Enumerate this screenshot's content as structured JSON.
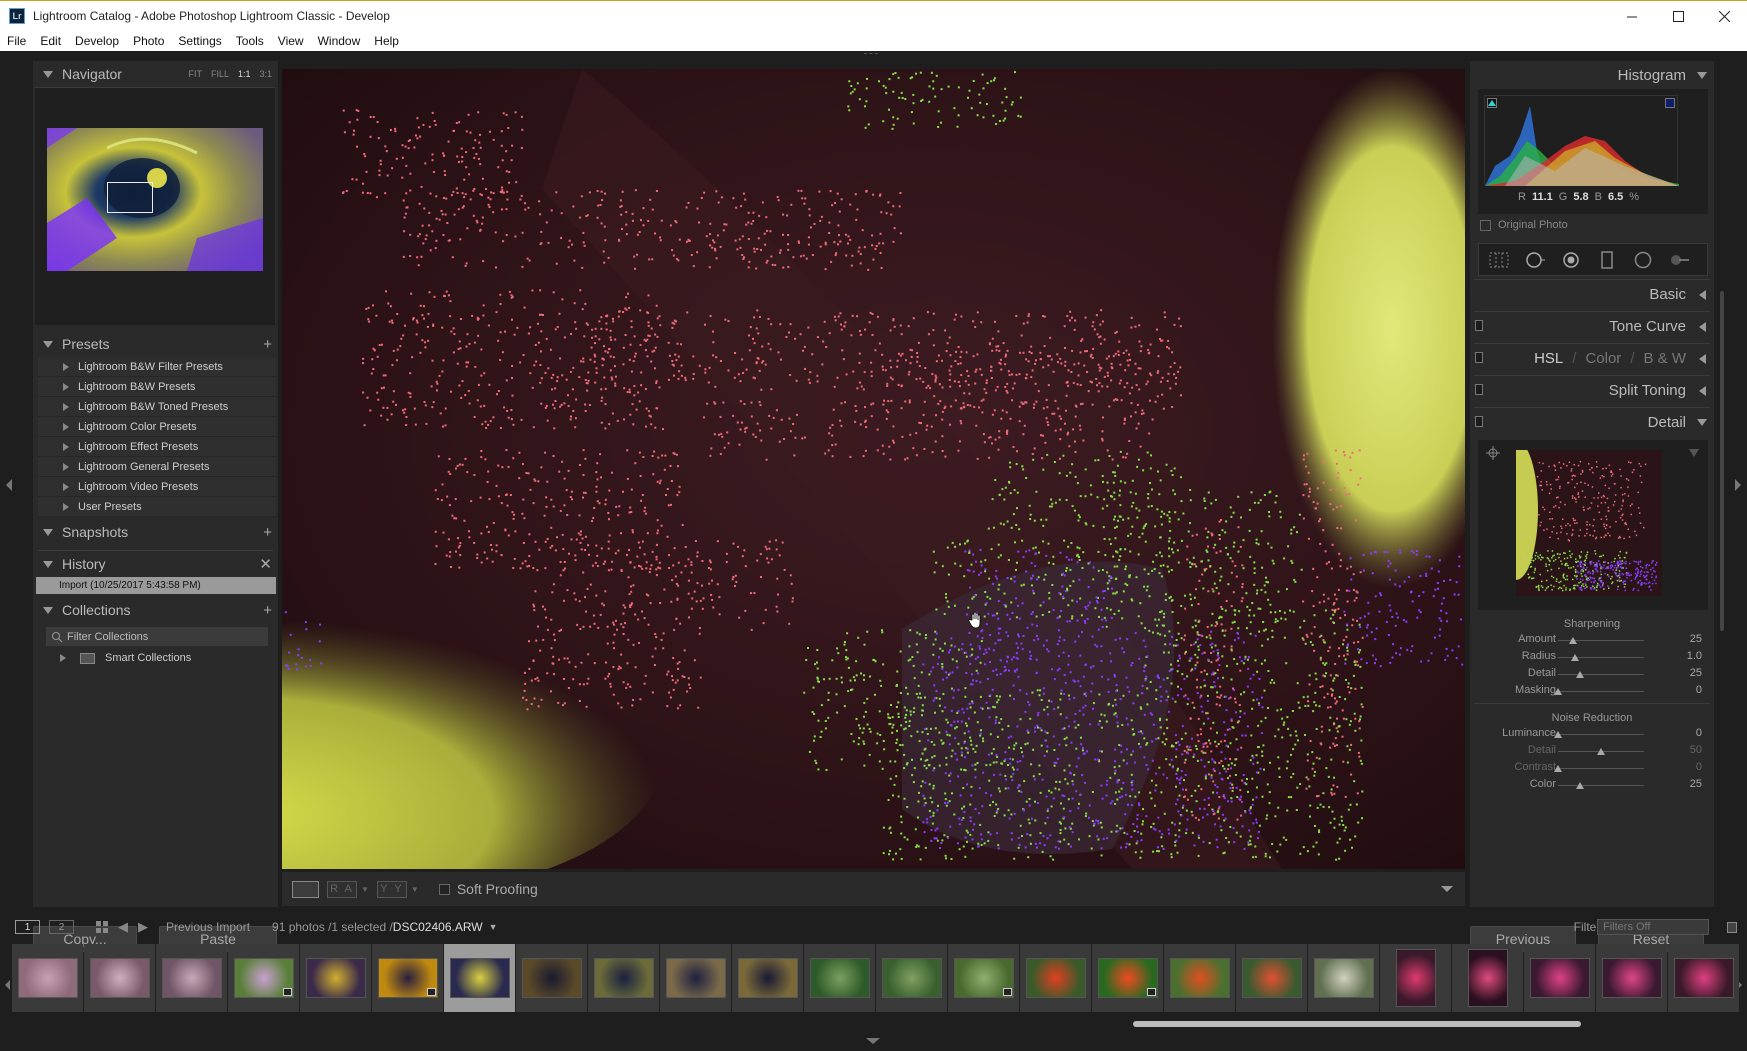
{
  "window": {
    "app_icon": "Lr",
    "title": "Lightroom Catalog - Adobe Photoshop Lightroom Classic - Develop",
    "controls": [
      "minimize-icon",
      "maximize-icon",
      "close-icon"
    ]
  },
  "menu": [
    "File",
    "Edit",
    "Develop",
    "Photo",
    "Settings",
    "Tools",
    "View",
    "Window",
    "Help"
  ],
  "left": {
    "navigator": {
      "title": "Navigator",
      "zoom": [
        "FIT",
        "FILL",
        "1:1",
        "3:1"
      ],
      "zoom_active": "1:1"
    },
    "presets": {
      "title": "Presets",
      "items": [
        "Lightroom B&W Filter Presets",
        "Lightroom B&W Presets",
        "Lightroom B&W Toned Presets",
        "Lightroom Color Presets",
        "Lightroom Effect Presets",
        "Lightroom General Presets",
        "Lightroom Video Presets",
        "User Presets"
      ]
    },
    "snapshots": {
      "title": "Snapshots"
    },
    "history": {
      "title": "History",
      "items": [
        "Import (10/25/2017 5:43:58 PM)"
      ]
    },
    "collections": {
      "title": "Collections",
      "filter": "Filter Collections",
      "items": [
        "Smart Collections"
      ]
    },
    "copy_label": "Copy...",
    "paste_label": "Paste"
  },
  "toolbar": {
    "soft_proofing": "Soft Proofing",
    "ra_label": "R A",
    "yy_label": "Y Y"
  },
  "right": {
    "histogram": {
      "title": "Histogram",
      "r_label": "R",
      "r_value": "11.1",
      "g_label": "G",
      "g_value": "5.8",
      "b_label": "B",
      "b_value": "6.5",
      "unit": "%",
      "original_photo": "Original Photo"
    },
    "panels": {
      "basic": "Basic",
      "tone_curve": "Tone Curve",
      "hsl": "HSL",
      "color": "Color",
      "bw": "B & W",
      "slash": "/",
      "split_toning": "Split Toning",
      "detail": "Detail"
    },
    "sharpening": {
      "title": "Sharpening",
      "sliders": [
        {
          "label": "Amount",
          "value": "25",
          "fraction": 0.17
        },
        {
          "label": "Radius",
          "value": "1.0",
          "fraction": 0.2
        },
        {
          "label": "Detail",
          "value": "25",
          "fraction": 0.25
        },
        {
          "label": "Masking",
          "value": "0",
          "fraction": 0.0
        }
      ]
    },
    "noise_reduction": {
      "title": "Noise Reduction",
      "sliders": [
        {
          "label": "Luminance",
          "value": "0",
          "fraction": 0.0
        },
        {
          "label": "Detail",
          "value": "50",
          "fraction": 0.5
        },
        {
          "label": "Contrast",
          "value": "0",
          "fraction": 0.0
        },
        {
          "label": "Color",
          "value": "25",
          "fraction": 0.25
        }
      ]
    },
    "previous_label": "Previous",
    "reset_label": "Reset"
  },
  "filmstrip": {
    "monitor1": "1",
    "monitor2": "2",
    "source": "Previous Import",
    "count": "91 photos /1 selected /",
    "filename": "DSC02406.ARW",
    "filter_label": "Filter :",
    "filter_value": "Filters Off",
    "selected_index": 6
  },
  "colors": {
    "background": "#1e1e1e",
    "panel": "#2a2a2a",
    "mask_red": "#f06a78",
    "mask_green": "#86e04a",
    "mask_blue": "#8a3cff"
  }
}
